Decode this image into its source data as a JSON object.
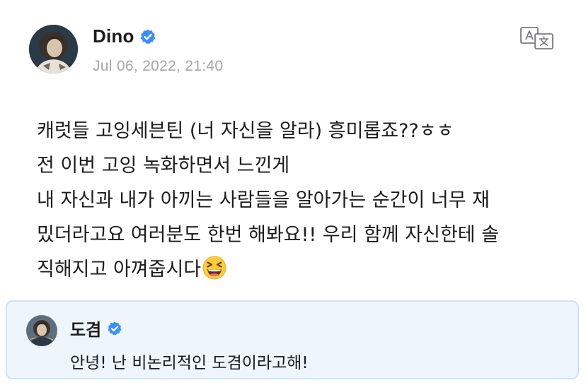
{
  "post": {
    "author": "Dino",
    "timestamp": "Jul 06, 2022, 21:40",
    "body_lines": [
      "캐럿들 고잉세븐틴 (너 자신을 알라) 흥미롭죠??ㅎㅎ",
      "전 이번 고잉 녹화하면서 느낀게",
      "내 자신과 내가 아끼는 사람들을 알아가는 순간이 너무 재",
      "밌더라고요 여러분도 한번 해봐요!! 우리 함께 자신한테 솔",
      "직해지고 아껴줍시다"
    ],
    "emoji": "grinning-squinting-face"
  },
  "reply": {
    "author": "도겸",
    "text": "안녕! 난 비논리적인 도겸이라고해!"
  },
  "icons": {
    "verified": "verified-badge-icon",
    "translate": "translate-icon"
  },
  "colors": {
    "verified_blue": "#3e8ef7",
    "reply_background": "#eef6fc",
    "reply_border": "#cfe3f4",
    "timestamp_gray": "#a6a6ab"
  }
}
